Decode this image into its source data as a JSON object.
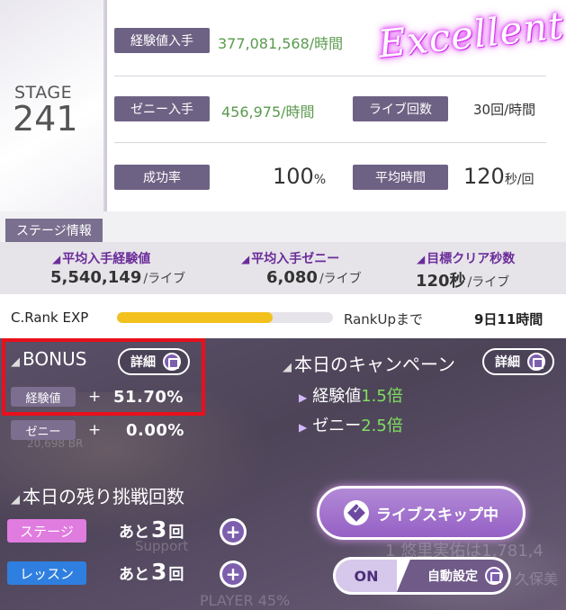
{
  "stage": {
    "label": "STAGE",
    "number": "241"
  },
  "badge": {
    "text": "Excellent"
  },
  "stats": {
    "exp_label": "経験値入手",
    "exp_value": "377,081,568/時間",
    "zeny_label": "ゼニー入手",
    "zeny_value": "456,975/時間",
    "live_label": "ライブ回数",
    "live_value": "30回/時間",
    "success_label": "成功率",
    "success_value": "100",
    "success_unit": "%",
    "avg_label": "平均時間",
    "avg_value": "120",
    "avg_unit": "秒/回"
  },
  "info": {
    "tab": "ステージ情報",
    "items": [
      {
        "label": "平均入手経験値",
        "value": "5,540,149",
        "unit": "/ライブ"
      },
      {
        "label": "平均入手ゼニー",
        "value": "6,080",
        "unit": "/ライブ"
      },
      {
        "label": "目標クリア秒数",
        "value": "120秒",
        "unit": "/ライブ"
      }
    ]
  },
  "rank": {
    "label": "C.Rank EXP",
    "progress_fraction": 0.72,
    "rankup_label": "RankUpまで",
    "time": "9日11時間"
  },
  "bonus": {
    "title": "BONUS",
    "detail_label": "詳細",
    "exp_tag": "経験値",
    "exp_plus": "+",
    "exp_pct": "51.70%",
    "zeny_tag": "ゼニー",
    "zeny_plus": "+",
    "zeny_pct": "0.00%"
  },
  "campaign": {
    "title": "本日のキャンペーン",
    "detail_label": "詳細",
    "items": [
      {
        "name": "経験値",
        "mult": "1.5倍"
      },
      {
        "name": "ゼニー",
        "mult": "2.5倍"
      }
    ]
  },
  "remaining": {
    "title": "本日の残り挑戦回数",
    "rows": [
      {
        "tag": "ステージ",
        "prefix": "あと",
        "count": "3",
        "suffix": "回"
      },
      {
        "tag": "レッスン",
        "prefix": "あと",
        "count": "3",
        "suffix": "回"
      }
    ]
  },
  "skip": {
    "label": "ライブスキップ中"
  },
  "auto": {
    "on_label": "ON",
    "label": "自動設定"
  },
  "background_text": {
    "a": "Support",
    "b": "PLAYER 45%",
    "c": "1 悠里実佑は1,781,4",
    "d": "久保美",
    "e": "20,698 BR"
  },
  "colors": {
    "accent": "#6e6284",
    "green": "#5a9a4e",
    "highlight": "#e8101c",
    "bar": "#f2c11d"
  }
}
